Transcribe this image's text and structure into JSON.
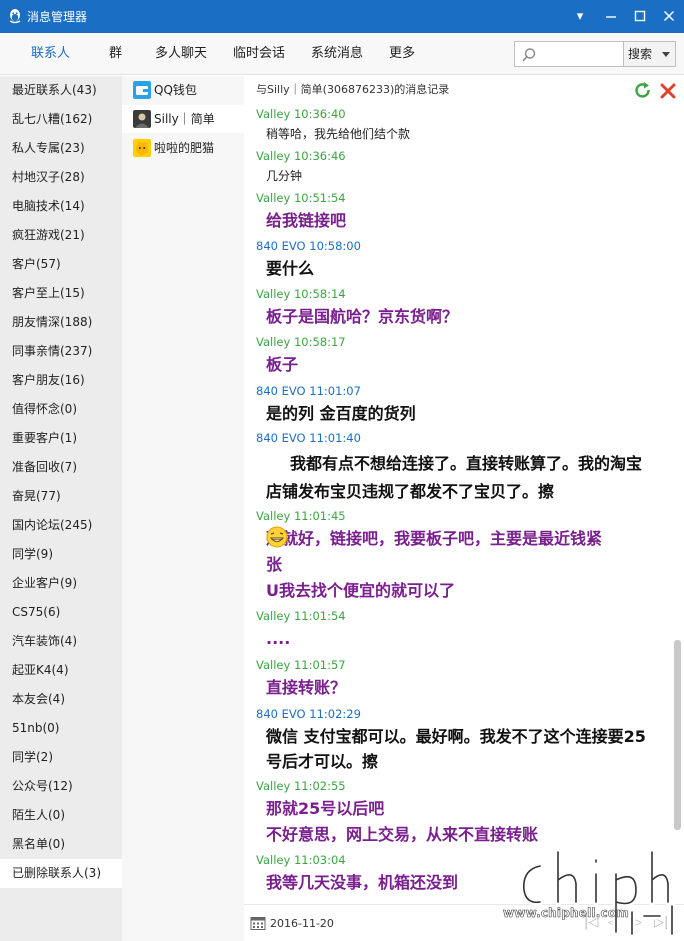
{
  "window": {
    "title": "消息管理器",
    "controls": {
      "menu": "▾",
      "minimize": "—",
      "maximize": "☐",
      "close": "✕"
    }
  },
  "tabs": [
    "联系人",
    "群",
    "多人聊天",
    "临时会话",
    "系统消息",
    "更多"
  ],
  "search": {
    "placeholder": "",
    "button_label": "搜索"
  },
  "groups": [
    "最近联系人(43)",
    "乱七八糟(162)",
    "私人专属(23)",
    "村地汉子(28)",
    "电脑技术(14)",
    "疯狂游戏(21)",
    "客户(57)",
    "客户至上(15)",
    "朋友情深(188)",
    "同事亲情(237)",
    "客户朋友(16)",
    "值得怀念(0)",
    "重要客户(1)",
    "准备回收(7)",
    "奋晃(77)",
    "国内论坛(245)",
    "同学(9)",
    "企业客户(9)",
    "CS75(6)",
    "汽车装饰(4)",
    "起亚K4(4)",
    "本友会(4)",
    "51nb(0)",
    "同学(2)",
    "公众号(12)",
    "陌生人(0)",
    "黑名单(0)",
    "已删除联系人(3)"
  ],
  "contacts": [
    {
      "name": "QQ钱包",
      "icon": "wallet-icon"
    },
    {
      "name": "Silly｜简单",
      "icon": "avatar-icon"
    },
    {
      "name": "啦啦的肥猫",
      "icon": "cat-avatar-icon"
    }
  ],
  "header": {
    "title": "与Silly｜简单(306876233)的消息记录",
    "refresh_icon": "refresh-icon",
    "delete_icon": "delete-icon"
  },
  "messages": [
    {
      "sender": "Valley",
      "time": "10:36:40",
      "lines": [
        "稍等哈，我先给他们结个款"
      ]
    },
    {
      "sender": "Valley",
      "time": "10:36:46",
      "lines": [
        "几分钟"
      ]
    },
    {
      "sender": "Valley",
      "time": "10:51:54",
      "lines": [
        "给我链接吧"
      ]
    },
    {
      "sender": "840 EVO",
      "time": "10:58:00",
      "lines": [
        "要什么"
      ]
    },
    {
      "sender": "Valley",
      "time": "10:58:14",
      "lines": [
        "板子是国航哈？京东货啊？"
      ]
    },
    {
      "sender": "Valley",
      "time": "10:58:17",
      "lines": [
        "板子"
      ]
    },
    {
      "sender": "840 EVO",
      "time": "11:01:07",
      "lines": [
        "是的列 金百度的货列"
      ]
    },
    {
      "sender": "840 EVO",
      "time": "11:01:40",
      "lines": [
        "我都有点不想给连接了。直接转账算了。我的淘宝",
        "店铺发布宝贝违规了都发不了宝贝了。擦"
      ]
    },
    {
      "sender": "Valley",
      "time": "11:01:45",
      "lines": [
        "那就好，链接吧，我要板子吧，主要是最近钱紧",
        "张",
        "U我去找个便宜的就可以了"
      ]
    },
    {
      "sender": "Valley",
      "time": "11:01:54",
      "lines": [
        "...."
      ]
    },
    {
      "sender": "Valley",
      "time": "11:01:57",
      "lines": [
        "直接转账？"
      ]
    },
    {
      "sender": "840 EVO",
      "time": "11:02:29",
      "lines": [
        "微信 支付宝都可以。最好啊。我发不了这个连接要25",
        "号后才可以。擦"
      ]
    },
    {
      "sender": "Valley",
      "time": "11:02:55",
      "lines": [
        "那就25号以后吧",
        "不好意思，网上交易，从来不直接转账"
      ]
    },
    {
      "sender": "Valley",
      "time": "11:03:04",
      "lines": [
        "我等几天没事，机箱还没到"
      ]
    }
  ],
  "footer": {
    "date": "2016-11-20",
    "nav": [
      "|◁",
      "◁",
      "▷",
      "▷|"
    ]
  },
  "watermark": {
    "text": "www.chiphell.com",
    "logo": "chiphell-logo"
  },
  "colors": {
    "titlebar": "#1a6fc4",
    "valley": "#3aa540",
    "evo": "#1a6fc4",
    "valley_text": "#7a1f8e",
    "evo_text": "#111111"
  }
}
